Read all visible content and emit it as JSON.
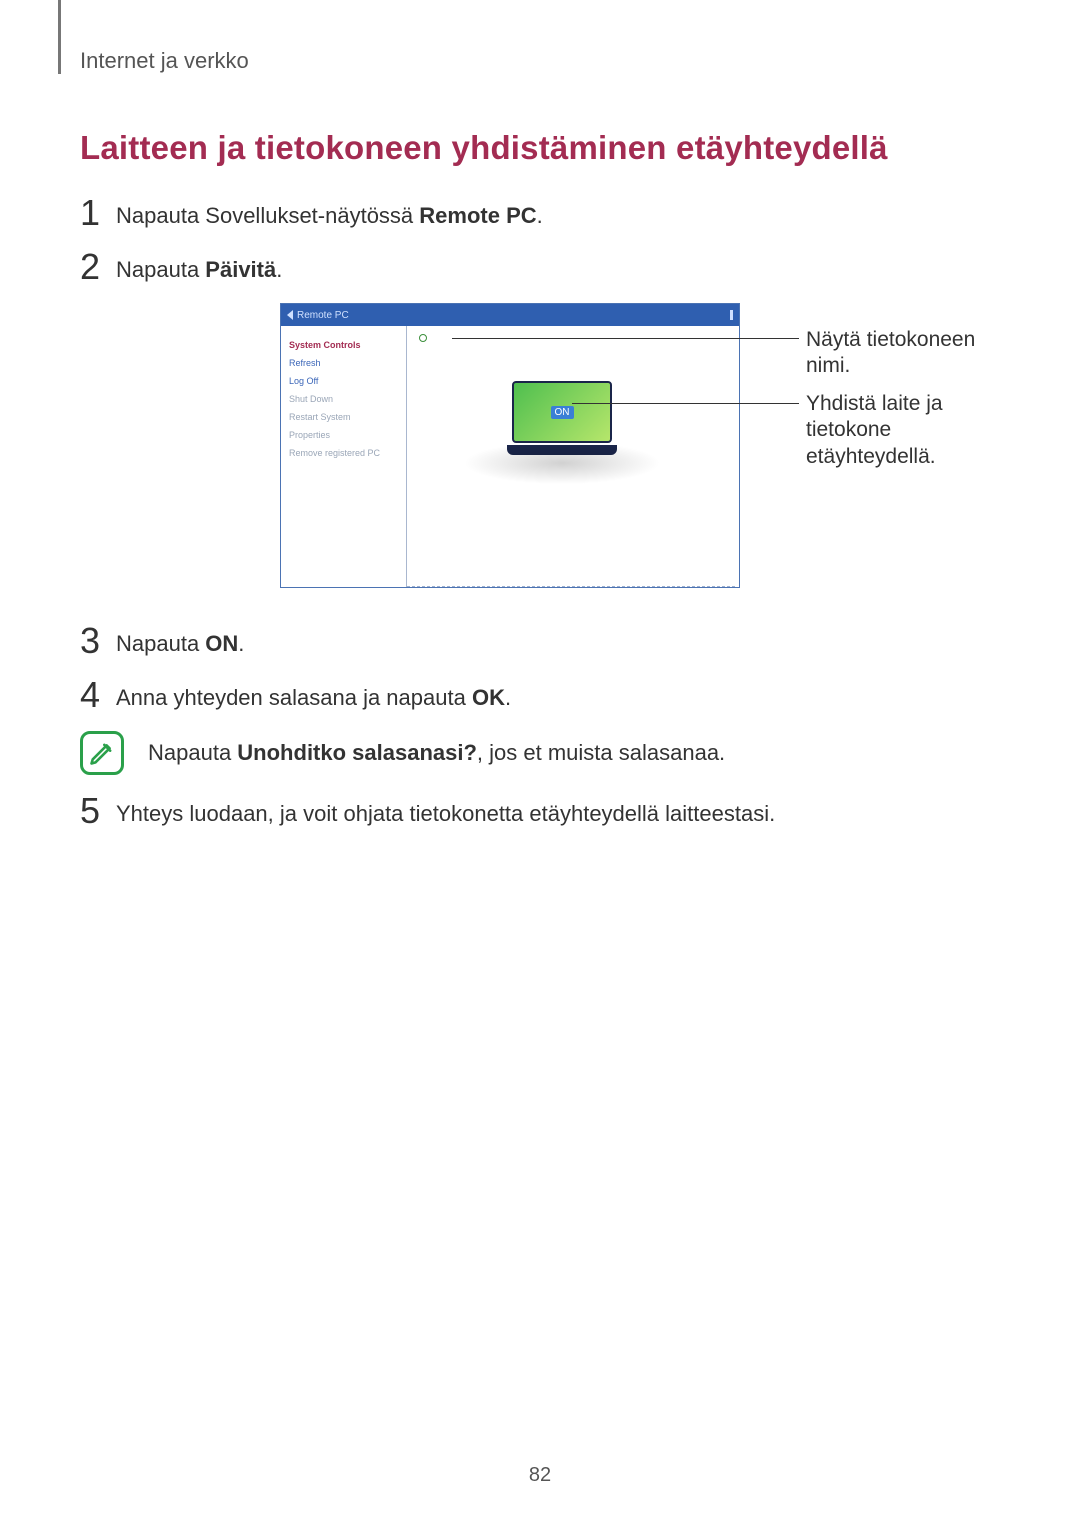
{
  "breadcrumb": "Internet ja verkko",
  "heading": "Laitteen ja tietokoneen yhdistäminen etäyhteydellä",
  "steps": {
    "s1_pre": "Napauta Sovellukset-näytössä ",
    "s1_bold": "Remote PC",
    "s1_post": ".",
    "s2_pre": "Napauta ",
    "s2_bold": "Päivitä",
    "s2_post": ".",
    "s3_pre": "Napauta ",
    "s3_bold": "ON",
    "s3_post": ".",
    "s4_pre": "Anna yhteyden salasana ja napauta ",
    "s4_bold": "OK",
    "s4_post": ".",
    "s5": "Yhteys luodaan, ja voit ohjata tietokonetta etäyhteydellä laitteestasi."
  },
  "note": {
    "pre": "Napauta ",
    "bold": "Unohditko salasanasi?",
    "post": ", jos et muista salasanaa."
  },
  "figure": {
    "panel_title": "Remote PC",
    "sidebar": {
      "system_controls": "System Controls",
      "refresh": "Refresh",
      "log_off": "Log Off",
      "shut_down": "Shut Down",
      "restart_system": "Restart System",
      "properties": "Properties",
      "remove_registered_pc": "Remove registered PC"
    },
    "pc_name_label": "",
    "on_label": "ON"
  },
  "callouts": {
    "c1": "Näytä tietokoneen nimi.",
    "c2": "Yhdistä laite ja tietokone etäyhteydellä."
  },
  "page_number": "82"
}
